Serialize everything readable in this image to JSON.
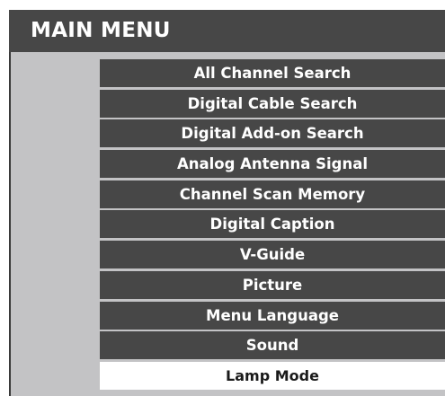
{
  "menu": {
    "title": "MAIN MENU",
    "items": [
      {
        "label": "All Channel Search"
      },
      {
        "label": "Digital Cable Search"
      },
      {
        "label": "Digital Add-on Search"
      },
      {
        "label": "Analog Antenna Signal"
      },
      {
        "label": "Channel Scan Memory"
      },
      {
        "label": "Digital Caption"
      },
      {
        "label": "V-Guide"
      },
      {
        "label": "Picture"
      },
      {
        "label": "Menu Language"
      },
      {
        "label": "Sound"
      },
      {
        "label": "Lamp Mode",
        "selected": true
      }
    ]
  },
  "colors": {
    "header_bg": "#474747",
    "item_bg": "#474747",
    "panel_bg": "#c3c3c5",
    "selected_bg": "#ffffff",
    "text": "#ffffff",
    "selected_text": "#1a1a1a"
  }
}
